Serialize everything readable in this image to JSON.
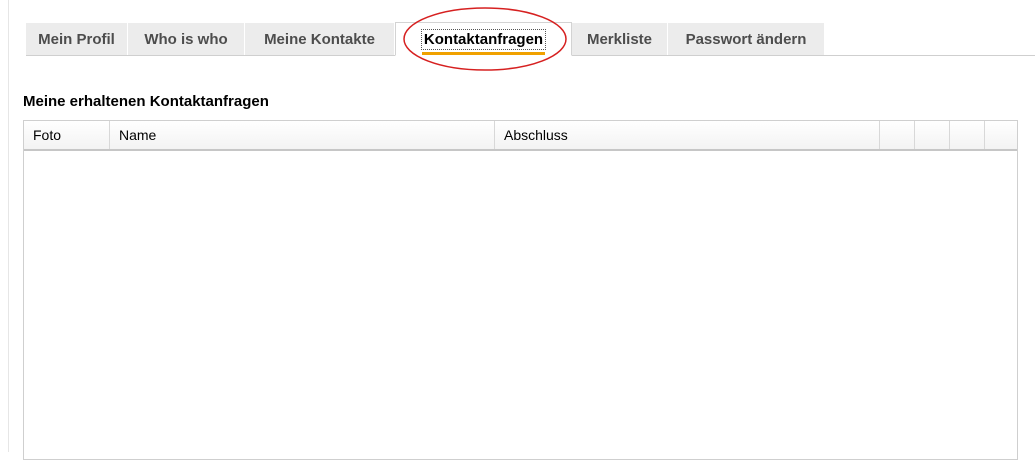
{
  "tabs": [
    {
      "label": "Mein Profil",
      "active": false
    },
    {
      "label": "Who is who",
      "active": false
    },
    {
      "label": "Meine Kontakte",
      "active": false
    },
    {
      "label": "Kontaktanfragen",
      "active": true
    },
    {
      "label": "Merkliste",
      "active": false
    },
    {
      "label": "Passwort ändern",
      "active": false
    }
  ],
  "section": {
    "title": "Meine erhaltenen Kontaktanfragen"
  },
  "table": {
    "columns": [
      "Foto",
      "Name",
      "Abschluss",
      "",
      "",
      "",
      ""
    ],
    "rows": []
  },
  "colors": {
    "active_tab_underline": "#f0a100",
    "annotation_circle": "#d62020"
  }
}
